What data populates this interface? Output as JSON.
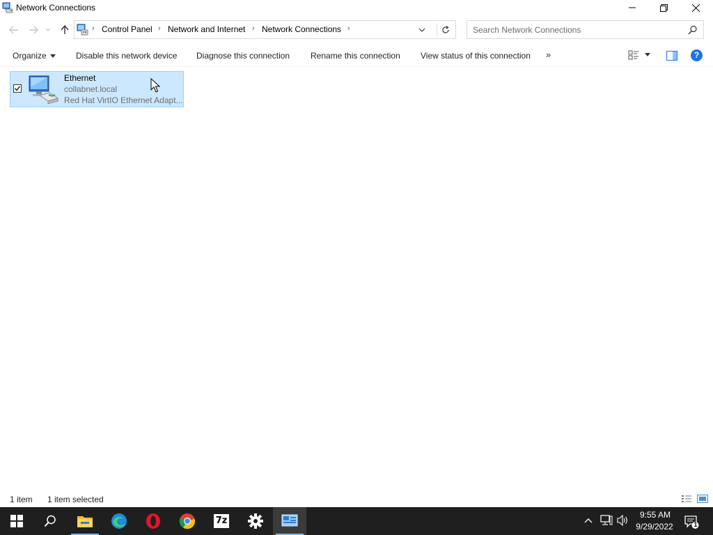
{
  "window": {
    "title": "Network Connections",
    "icons": {
      "app": "network-connections-icon",
      "minimize": "minimize-icon",
      "maximize": "restore-icon",
      "close": "close-icon"
    }
  },
  "address": {
    "breadcrumbs": [
      "Control Panel",
      "Network and Internet",
      "Network Connections"
    ],
    "search_placeholder": "Search Network Connections"
  },
  "toolbar": {
    "organize": "Organize",
    "disable": "Disable this network device",
    "diagnose": "Diagnose this connection",
    "rename": "Rename this connection",
    "view_status": "View status of this connection",
    "more": "»",
    "help": "?"
  },
  "items": [
    {
      "name": "Ethernet",
      "domain": "collabnet.local",
      "adapter": "Red Hat VirtIO Ethernet Adapt...",
      "selected": true,
      "icon": "ethernet-adapter-icon"
    }
  ],
  "status": {
    "count": "1 item",
    "selected": "1 item selected"
  },
  "taskbar": {
    "apps": [
      "start-icon",
      "search-icon",
      "file-explorer-icon",
      "edge-icon",
      "opera-icon",
      "chrome-icon",
      "7zip-icon",
      "settings-icon",
      "network-connections-icon"
    ],
    "sevenzip_label": "7z",
    "time": "9:55 AM",
    "date": "9/29/2022",
    "notifications": "1"
  },
  "colors": {
    "selection": "#cce8ff",
    "selection_border": "#99d1ff",
    "taskbar": "#1f1f1f",
    "accent": "#1a73e8"
  }
}
